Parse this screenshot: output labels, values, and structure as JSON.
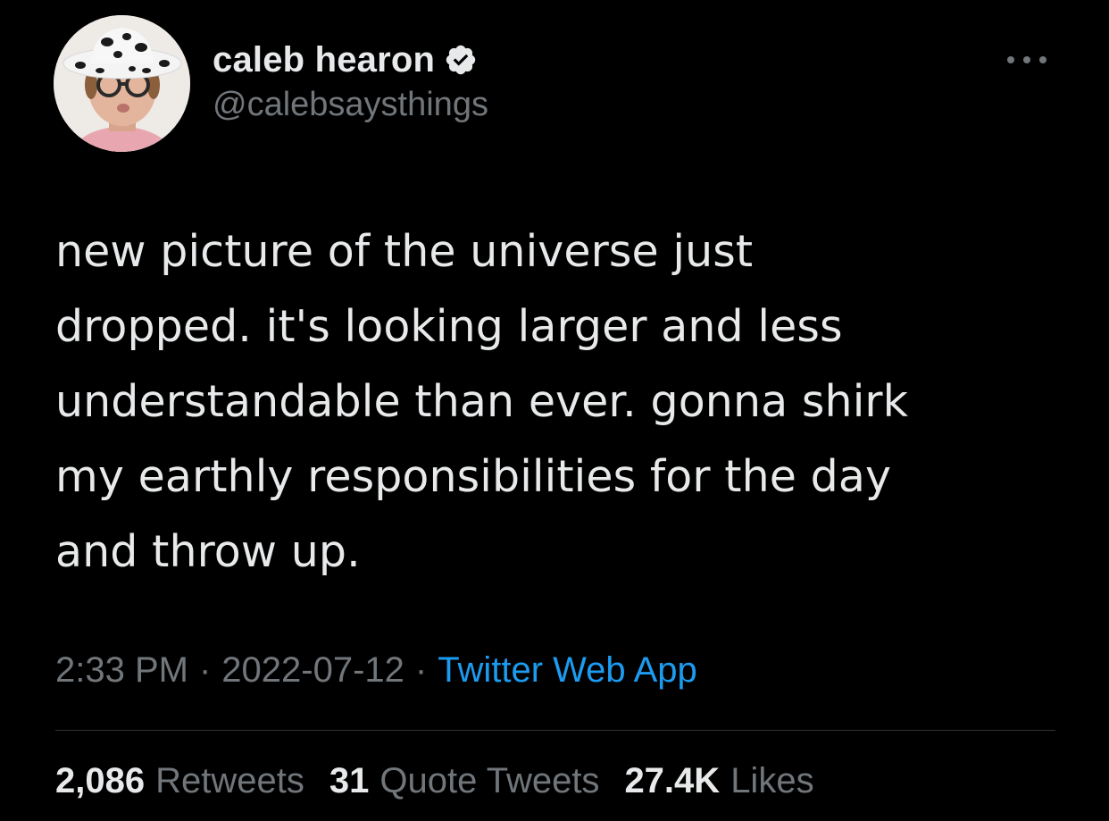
{
  "author": {
    "display_name": "caleb hearon",
    "handle": "@calebsaysthings",
    "verified": true
  },
  "icons": {
    "avatar": "avatar",
    "verified": "verified-badge-icon",
    "more": "more-options-icon"
  },
  "tweet": {
    "text": "new picture of the universe just\ndropped. it's looking larger and less\nunderstandable than ever. gonna shirk\nmy earthly responsibilities for the day\nand throw up."
  },
  "meta": {
    "time": "2:33 PM",
    "separator": "·",
    "date": "2022-07-12",
    "source": "Twitter Web App"
  },
  "stats": {
    "retweets_count": "2,086",
    "retweets_label": "Retweets",
    "quotes_count": "31",
    "quotes_label": "Quote Tweets",
    "likes_count": "27.4K",
    "likes_label": "Likes"
  },
  "colors": {
    "background": "#000000",
    "primary_text": "#e7e9ea",
    "secondary_text": "#71767b",
    "link": "#1d9bf0",
    "divider": "#2f3336"
  }
}
